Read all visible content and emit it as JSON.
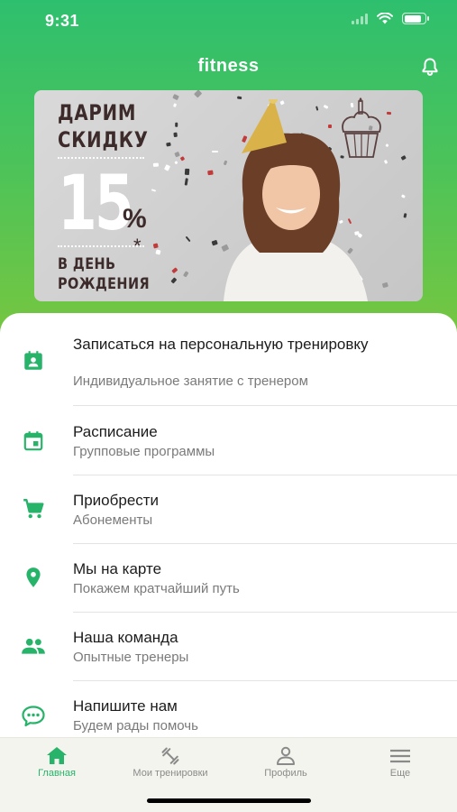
{
  "status": {
    "time": "9:31",
    "battery_level": 0.85
  },
  "app": {
    "title": "fitness",
    "accent_color": "#27b36a"
  },
  "banner": {
    "line1": "ДАРИМ",
    "line2": "СКИДКУ",
    "percent": "15",
    "percent_sign": "%",
    "line3": "В ДЕНЬ",
    "line4": "РОЖДЕНИЯ",
    "star": "*"
  },
  "menu": [
    {
      "icon": "calendar-person-icon",
      "title": "Записаться на персональную тренировку",
      "subtitle": "Индивидуальное занятие с тренером"
    },
    {
      "icon": "calendar-icon",
      "title": "Расписание",
      "subtitle": "Групповые программы"
    },
    {
      "icon": "cart-icon",
      "title": "Приобрести",
      "subtitle": "Абонементы"
    },
    {
      "icon": "location-pin-icon",
      "title": "Мы на карте",
      "subtitle": "Покажем кратчайший путь"
    },
    {
      "icon": "team-icon",
      "title": "Наша команда",
      "subtitle": "Опытные тренеры"
    },
    {
      "icon": "chat-icon",
      "title": "Напишите нам",
      "subtitle": "Будем рады помочь"
    }
  ],
  "tabs": [
    {
      "icon": "home-icon",
      "label": "Главная",
      "active": true
    },
    {
      "icon": "dumbbell-icon",
      "label": "Мои тренировки",
      "active": false
    },
    {
      "icon": "profile-icon",
      "label": "Профиль",
      "active": false
    },
    {
      "icon": "menu-icon",
      "label": "Еще",
      "active": false
    }
  ]
}
